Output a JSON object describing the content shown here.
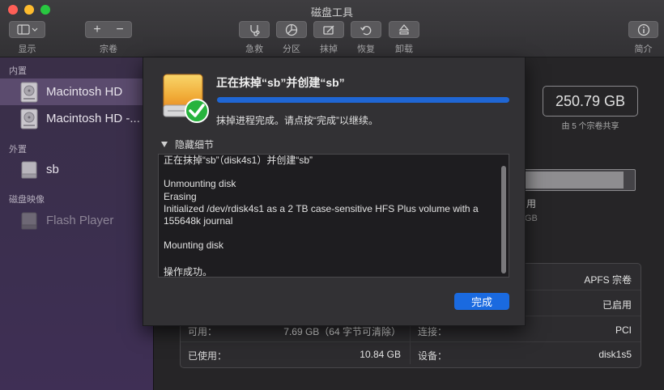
{
  "window": {
    "title": "磁盘工具"
  },
  "toolbar": {
    "display_label": "显示",
    "volume_label": "宗卷",
    "firstaid_label": "急救",
    "partition_label": "分区",
    "erase_label": "抹掉",
    "restore_label": "恢复",
    "unmount_label": "卸载",
    "info_label": "简介",
    "add_symbol": "+",
    "remove_symbol": "−"
  },
  "sidebar": {
    "internal_header": "内置",
    "external_header": "外置",
    "images_header": "磁盘映像",
    "items": [
      {
        "label": "Macintosh HD",
        "selected": true,
        "icon": "internal-disk-icon"
      },
      {
        "label": "Macintosh HD -...",
        "selected": false,
        "icon": "internal-disk-icon"
      },
      {
        "label": "sb",
        "selected": false,
        "icon": "external-disk-icon"
      },
      {
        "label": "Flash Player",
        "selected": false,
        "dimmed": true,
        "icon": "disk-image-icon"
      }
    ]
  },
  "main": {
    "capacity": "250.79 GB",
    "capacity_sub": "由 5 个宗卷共享",
    "partial_used_label": "用",
    "partial_gb": "GB",
    "info": {
      "left": [
        {
          "label": "可用：",
          "value": "7.69 GB（64 字节可清除）"
        },
        {
          "label": "已使用：",
          "value": "10.84 GB"
        }
      ],
      "right": [
        {
          "label": "",
          "value": "APFS 宗卷"
        },
        {
          "label": "",
          "value": "已启用"
        },
        {
          "label": "连接：",
          "value": "PCI"
        },
        {
          "label": "设备：",
          "value": "disk1s5"
        }
      ]
    }
  },
  "sheet": {
    "title": "正在抹掉“sb”并创建“sb”",
    "progress": 1.0,
    "message": "抹掉进程完成。请点按“完成”以继续。",
    "details_toggle": "隐藏细节",
    "log": [
      "正在抹掉“sb”（disk4s1）并创建“sb”",
      "",
      "Unmounting disk",
      "Erasing",
      "Initialized /dev/rdisk4s1 as a 2 TB case-sensitive HFS Plus volume with a",
      "155648k journal",
      "",
      "Mounting disk",
      "",
      "操作成功。"
    ],
    "done_button": "完成"
  },
  "colors": {
    "accent": "#1a6ae0",
    "progress": "#1f66d4",
    "success": "#27b33d"
  }
}
